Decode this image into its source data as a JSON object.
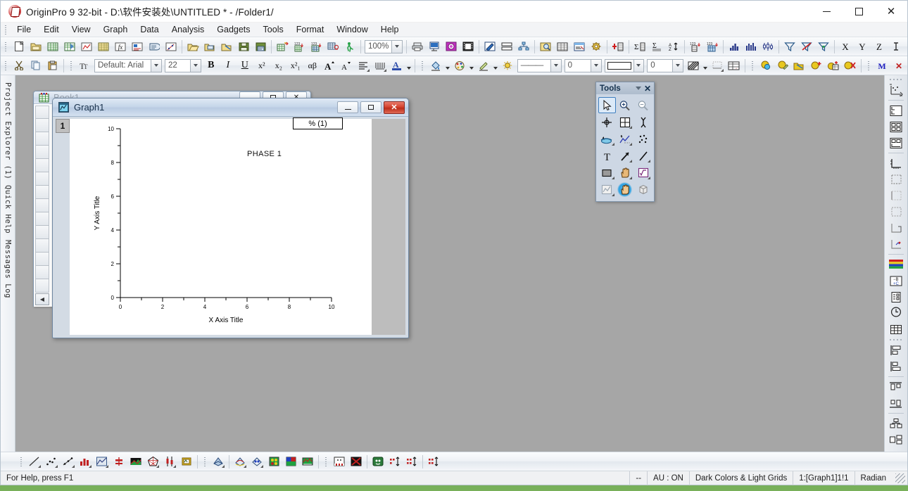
{
  "window": {
    "title": "OriginPro 9 32-bit - D:\\软件安装处\\UNTITLED * - /Folder1/",
    "app_icon": "origin-app-icon",
    "controls": {
      "minimize": "–",
      "maximize": "□",
      "close": "✕"
    }
  },
  "menu": [
    {
      "label": "File"
    },
    {
      "label": "Edit"
    },
    {
      "label": "View"
    },
    {
      "label": "Graph"
    },
    {
      "label": "Data"
    },
    {
      "label": "Analysis"
    },
    {
      "label": "Gadgets"
    },
    {
      "label": "Tools"
    },
    {
      "label": "Format"
    },
    {
      "label": "Window"
    },
    {
      "label": "Help"
    }
  ],
  "standard_toolbar": {
    "zoom_value": "100%",
    "icons": [
      "new-project-icon",
      "new-folder-icon",
      "new-workbook-icon",
      "new-excel-icon",
      "new-graph-icon",
      "new-matrix-icon",
      "new-function-icon",
      "new-layout-icon",
      "new-notes-icon",
      "new-graph-3d-icon",
      "open-icon",
      "open-template-icon",
      "open-excel-icon",
      "save-project-icon",
      "save-template-icon",
      "import-wizard-icon",
      "import-single-ascii-icon",
      "import-multiple-ascii-icon",
      "refresh-icon",
      "run-script-icon",
      "print-icon",
      "print-preview-icon",
      "export-page-icon",
      "export-video-icon",
      "annotation-icon",
      "layer-management-icon",
      "hierarchy-icon",
      "project-explorer-icon",
      "results-log-icon",
      "command-window-icon",
      "code-builder-icon",
      "add-new-columns-icon"
    ]
  },
  "analysis_toolbar": {
    "icons": [
      "statistics-columns-icon",
      "statistics-rows-icon",
      "sort-worksheet-icon",
      "normalize-icon",
      "frequency-count-icon",
      "histogram-icon",
      "column-chart-icon",
      "box-chart-icon",
      "filter-icon",
      "delete-filter-icon",
      "reapply-filter-icon",
      "set-as-x-icon",
      "set-as-y-icon",
      "set-as-z-icon",
      "set-as-error-icon",
      "set-as-label-icon"
    ]
  },
  "format_toolbar": {
    "font_name": "Default: Arial",
    "font_size": "22",
    "bold": "B",
    "italic": "I",
    "underline": "U",
    "superscript": "x²",
    "subscript": "x₂",
    "supersub": "x²₁",
    "greek": "αβ",
    "increase_font": "A▲",
    "decrease_font": "A▼",
    "icons": [
      "cut-icon",
      "copy-icon",
      "paste-icon",
      "font-icon",
      "align-icon",
      "column-width-icon",
      "font-color-icon",
      "fill-color-icon",
      "palette-icon",
      "line-color-icon",
      "lightbulb-icon"
    ],
    "line_style_value": "———",
    "line_width_value": "0",
    "fill_pattern_value": "",
    "pattern_width_value": "0",
    "right_icons": [
      "pattern-icon",
      "grid-icon",
      "table-icon",
      "layer-contents-icon",
      "plot-setup-icon",
      "merge-graph-icon",
      "add-plot-icon",
      "add-data-icon",
      "remove-plot-icon",
      "masking-m-icon",
      "masking-x-icon"
    ]
  },
  "left_sidebar": {
    "tabs": [
      {
        "label": "Project Explorer (1)",
        "name": "project-explorer"
      },
      {
        "label": "Quick Help",
        "name": "quick-help"
      },
      {
        "label": "Messages Log",
        "name": "messages-log"
      }
    ]
  },
  "right_sidebar": {
    "icons": [
      "rescale-axes-icon",
      "stack-vertical-icon",
      "grid-2x2-icon",
      "grid-mixed-icon",
      "axes-ll-icon",
      "axes-dotted-icon",
      "axes-left-icon",
      "axes-box-icon",
      "axes-corner-icon",
      "axes-marks-icon",
      "color-bands-icon",
      "swap-bc-icon",
      "add-label-icon",
      "clock-icon",
      "table-icon",
      "align-top-icon",
      "align-bottom-icon",
      "align-left-icon",
      "align-right-icon",
      "distribute-h-icon",
      "distribute-v-icon"
    ]
  },
  "book1_window": {
    "title": "Book1",
    "icon": "workbook-icon",
    "buttons": {
      "minimize": "—",
      "restore": "❐",
      "close": "✕"
    },
    "row_count": 14,
    "scroll_button": "◀"
  },
  "graph1_window": {
    "title": "Graph1",
    "icon": "graph-window-icon",
    "buttons": {
      "minimize": "—",
      "restore": "❐",
      "close": "✕"
    },
    "layer_tab": "1"
  },
  "chart_data": {
    "type": "line",
    "title": "",
    "annotation": "PHASE 1",
    "legend": {
      "entries": [
        "% (1)"
      ],
      "position": "top-right"
    },
    "xlabel": "X Axis Title",
    "ylabel": "Y Axis Title",
    "xlim": [
      0,
      10
    ],
    "ylim": [
      0,
      10
    ],
    "xticks": [
      0,
      2,
      4,
      6,
      8,
      10
    ],
    "yticks": [
      0,
      2,
      4,
      6,
      8,
      10
    ],
    "grid": false,
    "series": [
      {
        "name": "% (1)",
        "x": [],
        "y": []
      }
    ]
  },
  "tools_palette": {
    "title": "Tools",
    "collapse": "▼",
    "close": "✕",
    "tools": [
      {
        "name": "pointer-tool-icon",
        "selected": true
      },
      {
        "name": "zoom-in-tool-icon"
      },
      {
        "name": "zoom-out-tool-icon"
      },
      {
        "name": "screen-reader-tool-icon"
      },
      {
        "name": "data-reader-tool-icon"
      },
      {
        "name": "data-selector-tool-icon"
      },
      {
        "name": "draw-data-tool-icon"
      },
      {
        "name": "regional-mask-tool-icon"
      },
      {
        "name": "scatter-mask-tool-icon"
      },
      {
        "name": "text-tool-icon"
      },
      {
        "name": "arrow-tool-icon"
      },
      {
        "name": "line-tool-icon"
      },
      {
        "name": "rectangle-tool-icon"
      },
      {
        "name": "pan-tool-icon"
      },
      {
        "name": "equation-tool-icon"
      },
      {
        "name": "region-tool-icon"
      },
      {
        "name": "magic-wand-tool-icon",
        "highlighted": true
      },
      {
        "name": "cube-tool-icon"
      }
    ]
  },
  "bottom_toolbar": {
    "icons": [
      "line-plot-icon",
      "scatter-plot-icon",
      "line-symbol-icon",
      "column-plot-icon",
      "area-plot-icon",
      "floating-bar-icon",
      "fill-area-icon",
      "polar-plot-icon",
      "high-low-close-icon",
      "ternary-icon",
      "3d-surface-icon",
      "3d-scatter-icon",
      "contour-icon",
      "image-plot-icon",
      "waterfall-icon",
      "template-library-icon",
      "delete-template-icon",
      "theme-icon",
      "stack-plots-icon",
      "unstack-plots-icon",
      "group-plots-icon"
    ]
  },
  "status_bar": {
    "left": "For Help, press F1",
    "cells": [
      "--",
      "AU : ON",
      "Dark Colors & Light Grids",
      "1:[Graph1]1!1",
      "Radian"
    ]
  }
}
